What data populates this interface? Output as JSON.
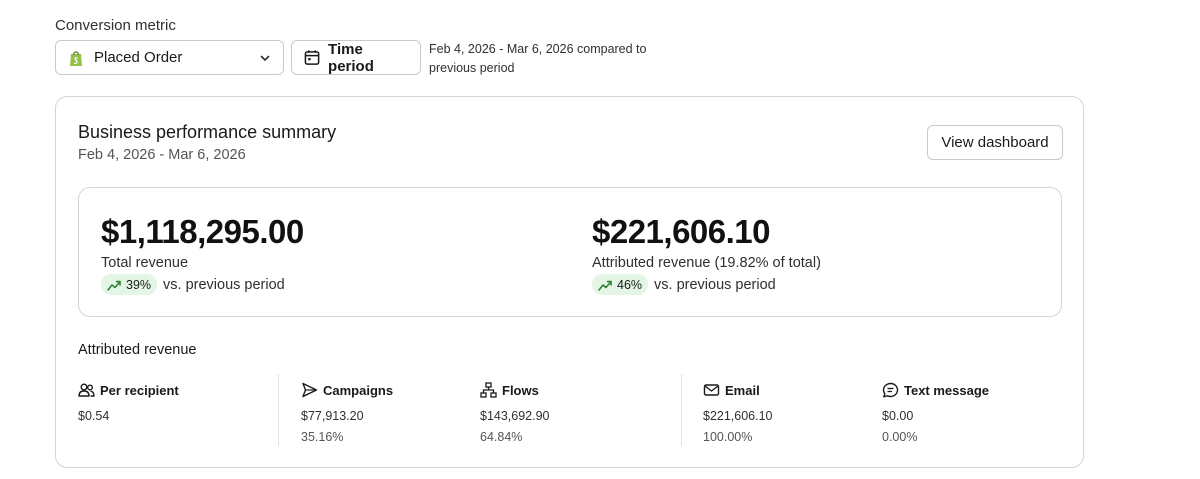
{
  "controls": {
    "metric_label": "Conversion metric",
    "metric_value": "Placed Order",
    "time_button": "Time period",
    "period_line1": "Feb 4, 2026 - Mar 6, 2026 compared to",
    "period_line2": "previous period"
  },
  "card": {
    "title": "Business performance summary",
    "date_range": "Feb 4, 2026 - Mar 6, 2026",
    "view_button": "View dashboard"
  },
  "summary": {
    "total": {
      "value": "$1,118,295.00",
      "caption": "Total revenue",
      "change": "39%",
      "vs": "vs. previous period"
    },
    "attributed": {
      "value": "$221,606.10",
      "caption": "Attributed revenue (19.82% of total)",
      "change": "46%",
      "vs": "vs. previous period"
    }
  },
  "attributed": {
    "title": "Attributed revenue",
    "metrics": [
      {
        "icon": "people-icon",
        "label": "Per recipient",
        "value": "$0.54",
        "pct": ""
      },
      {
        "icon": "send-icon",
        "label": "Campaigns",
        "value": "$77,913.20",
        "pct": "35.16%"
      },
      {
        "icon": "flows-icon",
        "label": "Flows",
        "value": "$143,692.90",
        "pct": "64.84%"
      },
      {
        "icon": "mail-icon",
        "label": "Email",
        "value": "$221,606.10",
        "pct": "100.00%"
      },
      {
        "icon": "chat-icon",
        "label": "Text message",
        "value": "$0.00",
        "pct": "0.00%"
      }
    ]
  },
  "colors": {
    "accent_green_bg": "#e3f5e4",
    "trend_green": "#2e7d32",
    "shopify_green": "#95bf47"
  }
}
